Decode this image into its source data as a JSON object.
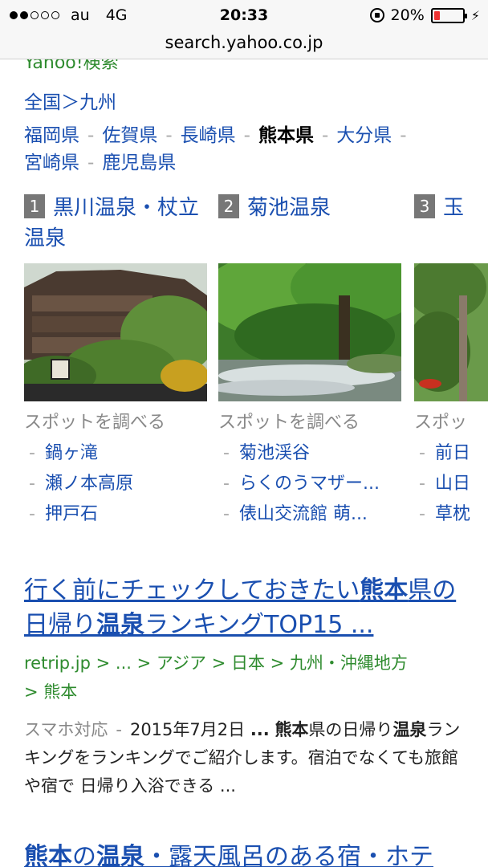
{
  "status_bar": {
    "carrier": "au",
    "network": "4G",
    "time": "20:33",
    "battery_text": "20%",
    "battery_level": 0.2
  },
  "url_bar": {
    "domain": "search.yahoo.co.jp"
  },
  "partial_brand": "Yahoo!検索",
  "breadcrumb": "全国＞九州",
  "prefectures": {
    "separator": "-",
    "items": [
      {
        "label": "福岡県",
        "current": false
      },
      {
        "label": "佐賀県",
        "current": false
      },
      {
        "label": "長崎県",
        "current": false
      },
      {
        "label": "熊本県",
        "current": true
      },
      {
        "label": "大分県",
        "current": false
      },
      {
        "label": "宮崎県",
        "current": false
      },
      {
        "label": "鹿児島県",
        "current": false
      }
    ]
  },
  "onsen_cards": [
    {
      "rank": "1",
      "name": "黒川温泉・杖立温泉",
      "spot_header": "スポットを調べる",
      "spots": [
        "鍋ヶ滝",
        "瀬ノ本高原",
        "押戸石"
      ]
    },
    {
      "rank": "2",
      "name": "菊池温泉",
      "spot_header": "スポットを調べる",
      "spots": [
        "菊池渓谷",
        "らくのうマザー...",
        "俵山交流館 萌..."
      ]
    },
    {
      "rank": "3",
      "name": "玉",
      "spot_header": "スポッ",
      "spots": [
        "前日",
        "山日",
        "草枕"
      ]
    }
  ],
  "result1": {
    "title_a": "行く前にチェックしておきたい",
    "title_b": "熊本",
    "title_c": "県の日帰り",
    "title_d": "温泉",
    "title_e": "ランキングTOP15 ...",
    "url_line1": "retrip.jp > ... > アジア > 日本 > 九州・沖縄地方",
    "url_line2": "> 熊本",
    "meta": "スマホ対応",
    "meta_sep": "-",
    "snippet_date": "2015年7月2日",
    "snippet_ellipsis": "...",
    "snippet_b1": "熊本",
    "snippet_t1": "県の日帰り",
    "snippet_b2": "温泉",
    "snippet_t2": "ランキングをランキングでご紹介します。宿泊でなくても旅館や宿で 日帰り入浴できる ..."
  },
  "result2": {
    "title_b": "熊本",
    "title_a": "の",
    "title_c": "温泉",
    "title_d": "・露天風呂のある宿・ホテ"
  }
}
